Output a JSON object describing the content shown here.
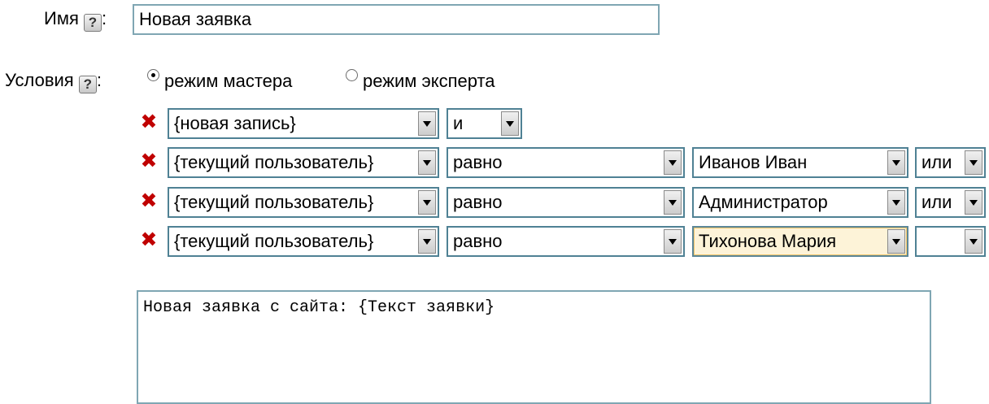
{
  "name_field": {
    "label": "Имя",
    "help_symbol": "?",
    "colon": ":",
    "value": "Новая заявка"
  },
  "conditions": {
    "label": "Условия",
    "help_symbol": "?",
    "colon": ":",
    "mode_wizard": "режим мастера",
    "mode_expert": "режим эксперта",
    "selected_mode": "режим мастера"
  },
  "condition_rows": [
    {
      "field": "{новая запись}",
      "logic": "и"
    },
    {
      "field": "{текущий пользователь}",
      "operator": "равно",
      "value": "Иванов Иван",
      "logic": "или"
    },
    {
      "field": "{текущий пользователь}",
      "operator": "равно",
      "value": "Администратор",
      "logic": "или"
    },
    {
      "field": "{текущий пользователь}",
      "operator": "равно",
      "value": "Тихонова Мария",
      "logic": ""
    }
  ],
  "message": {
    "text": "Новая заявка с сайта: {Текст заявки}"
  },
  "icons": {
    "delete": "delete-icon",
    "help": "help-icon",
    "dropdown": "chevron-down-icon"
  },
  "colors": {
    "delete": "#c00000",
    "select_border": "#4f8194",
    "input_border": "#7fa6b3",
    "highlight": "#fdf3d8"
  }
}
